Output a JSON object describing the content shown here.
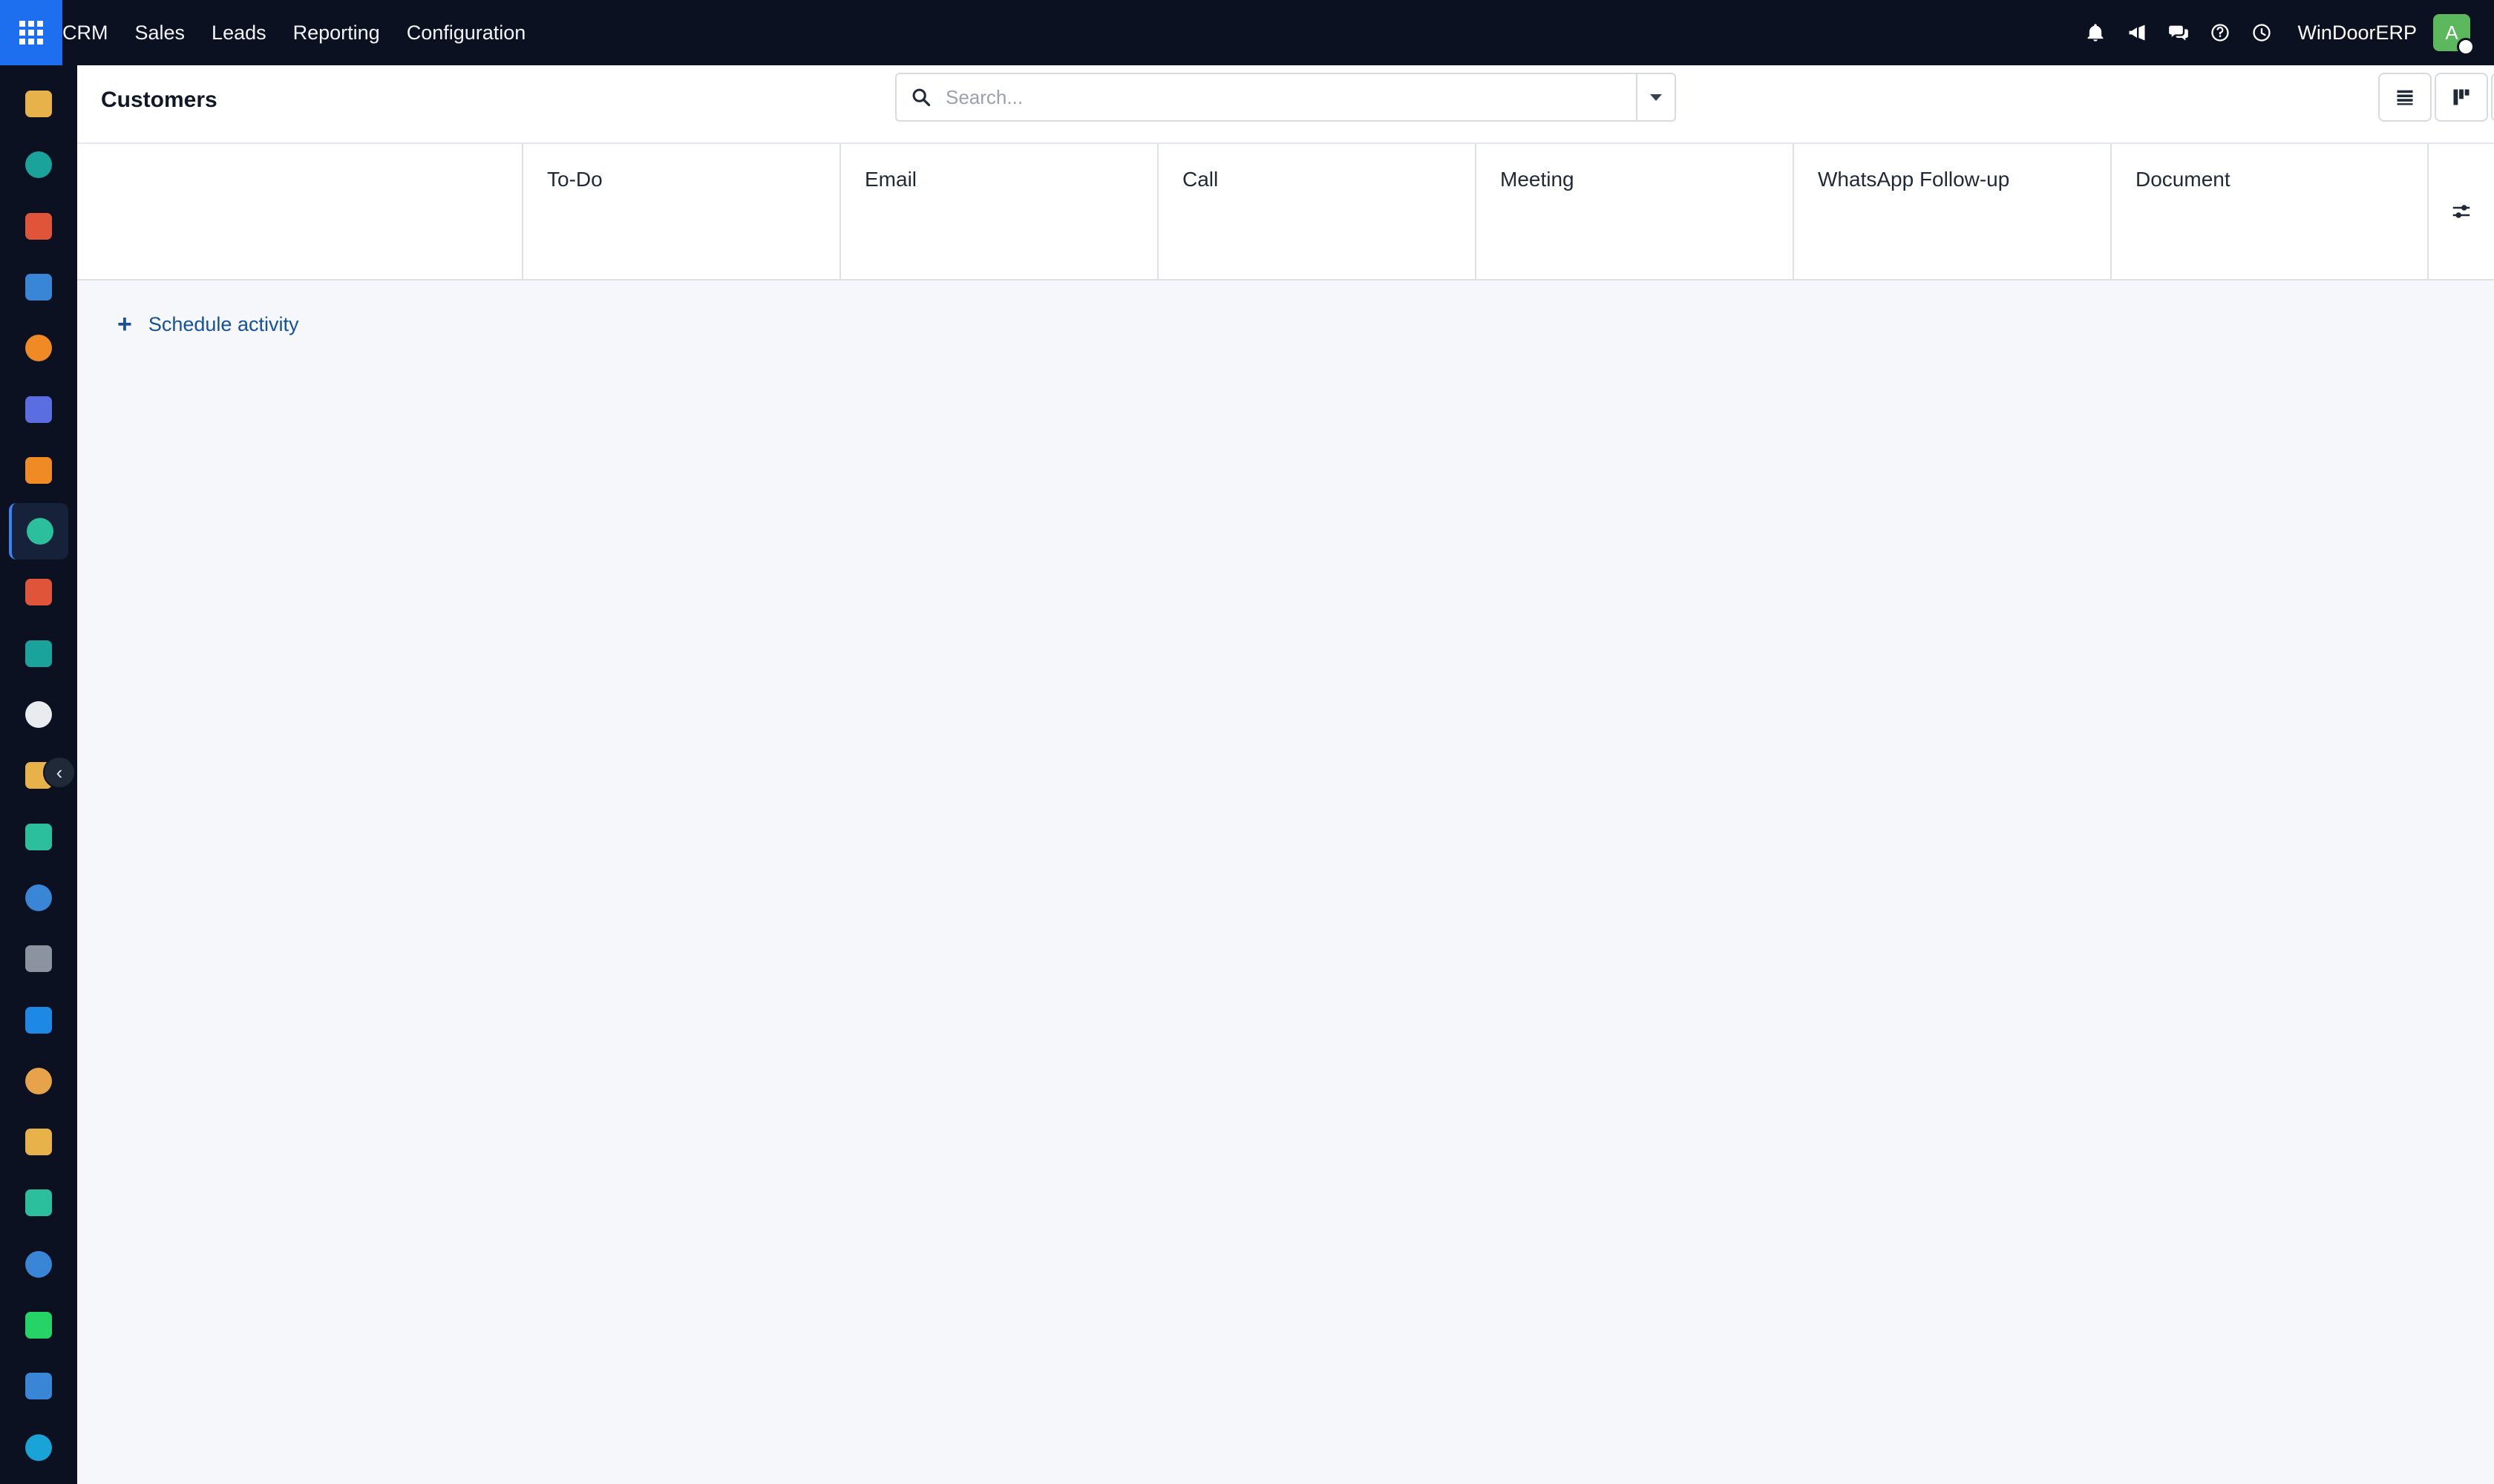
{
  "navbar": {
    "menu": [
      "CRM",
      "Sales",
      "Leads",
      "Reporting",
      "Configuration"
    ],
    "company": "WinDoorERP",
    "avatar_initial": "A",
    "icons": [
      "bell-icon",
      "megaphone-icon",
      "chat-icon",
      "help-icon",
      "clock-icon"
    ]
  },
  "control_panel": {
    "title": "Customers",
    "search_placeholder": "Search..."
  },
  "grid": {
    "columns": [
      "To-Do",
      "Email",
      "Call",
      "Meeting",
      "WhatsApp Follow-up",
      "Document"
    ],
    "schedule_label": "Schedule activity"
  },
  "sidebar_apps": [
    {
      "name": "app-documents",
      "color": "#e7b24a"
    },
    {
      "name": "app-contacts",
      "color": "#1aa39a"
    },
    {
      "name": "app-reporting",
      "color": "#e0553a"
    },
    {
      "name": "app-planning",
      "color": "#3a86d6"
    },
    {
      "name": "app-discuss",
      "color": "#f08a24"
    },
    {
      "name": "app-email-marketing",
      "color": "#5b6ee1"
    },
    {
      "name": "app-live-chat",
      "color": "#f08a24"
    },
    {
      "name": "app-crm",
      "color": "#2bbf9e"
    },
    {
      "name": "app-dashboards",
      "color": "#e0553a"
    },
    {
      "name": "app-employees",
      "color": "#1aa39a"
    },
    {
      "name": "app-inventory",
      "color": "#e9ecef"
    },
    {
      "name": "app-knowledge",
      "color": "#e7b24a"
    },
    {
      "name": "app-project",
      "color": "#2bbf9e"
    },
    {
      "name": "app-elearning",
      "color": "#3a86d6"
    },
    {
      "name": "app-products",
      "color": "#8b93a1"
    },
    {
      "name": "app-invoicing",
      "color": "#1e88e5"
    },
    {
      "name": "app-team",
      "color": "#e7a34a"
    },
    {
      "name": "app-calendar",
      "color": "#e7b24a"
    },
    {
      "name": "app-sign",
      "color": "#2bbf9e"
    },
    {
      "name": "app-website",
      "color": "#3a86d6"
    },
    {
      "name": "app-whatsapp",
      "color": "#25d366"
    },
    {
      "name": "app-timesheets",
      "color": "#3a86d6"
    },
    {
      "name": "app-spreadsheet",
      "color": "#1aa3d6"
    }
  ]
}
